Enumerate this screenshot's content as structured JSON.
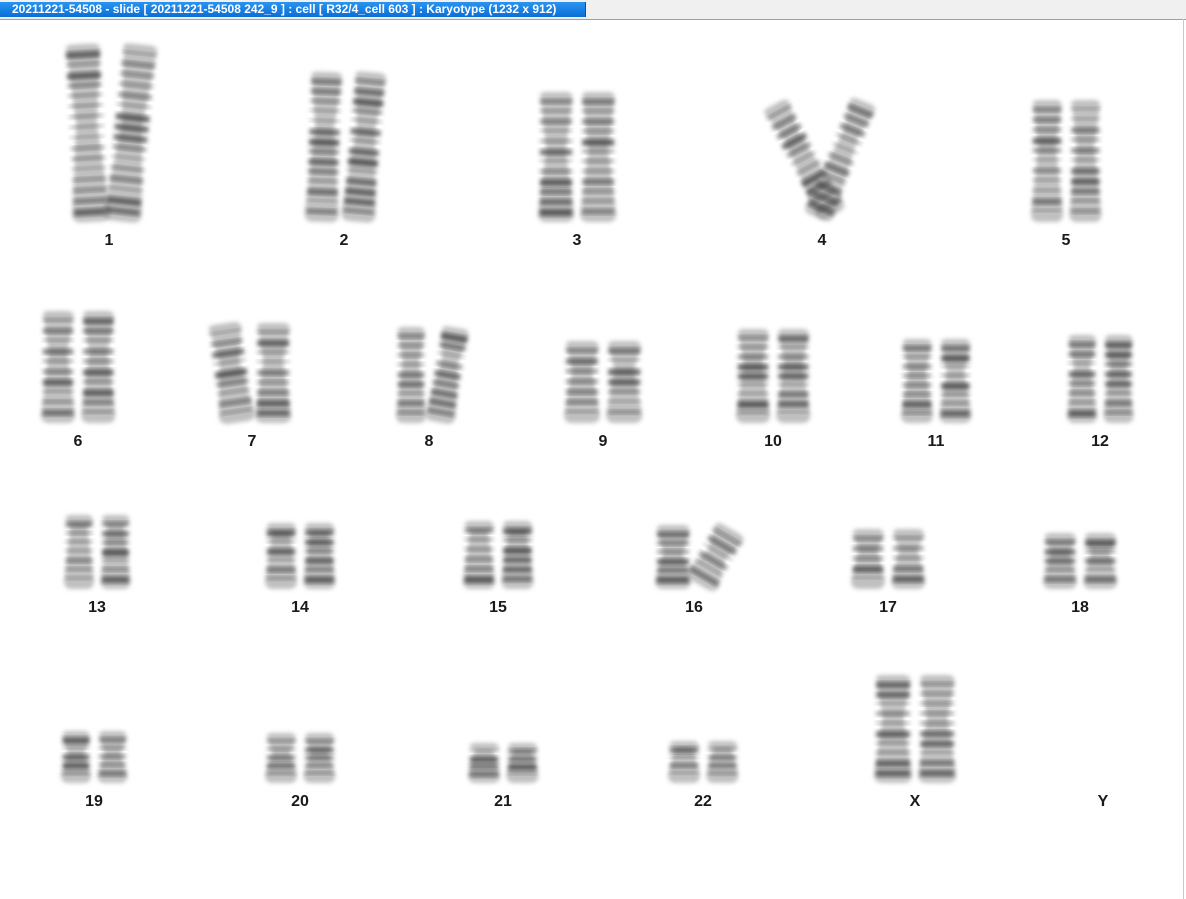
{
  "window": {
    "title": "20211221-54508 - slide [ 20211221-54508 242_9 ] : cell [ R32/4_cell 603 ] : Karyotype  (1232 x 912)"
  },
  "karyotype": {
    "chromosomes": [
      {
        "label": "1"
      },
      {
        "label": "2"
      },
      {
        "label": "3"
      },
      {
        "label": "4"
      },
      {
        "label": "5"
      },
      {
        "label": "6"
      },
      {
        "label": "7"
      },
      {
        "label": "8"
      },
      {
        "label": "9"
      },
      {
        "label": "10"
      },
      {
        "label": "11"
      },
      {
        "label": "12"
      },
      {
        "label": "13"
      },
      {
        "label": "14"
      },
      {
        "label": "15"
      },
      {
        "label": "16"
      },
      {
        "label": "17"
      },
      {
        "label": "18"
      },
      {
        "label": "19"
      },
      {
        "label": "20"
      },
      {
        "label": "21"
      },
      {
        "label": "22"
      },
      {
        "label": "X"
      },
      {
        "label": "Y"
      }
    ]
  }
}
